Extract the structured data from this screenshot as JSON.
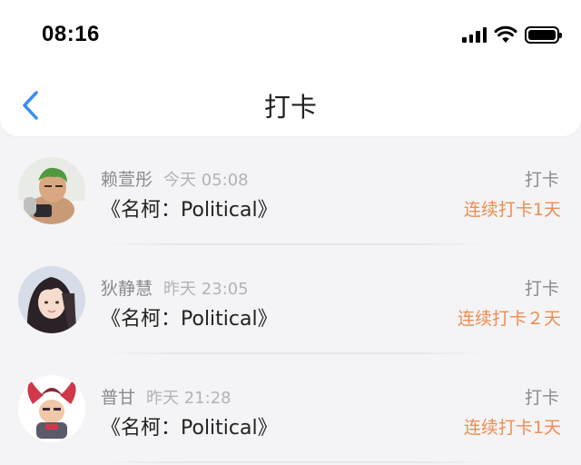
{
  "status_bar": {
    "time": "08:16"
  },
  "nav": {
    "title": "打卡"
  },
  "entries": [
    {
      "name": "赖萱彤",
      "time": "今天 05:08",
      "text": "《名柯：Political》",
      "label": "打卡",
      "streak": "连续打卡1天",
      "avatar_icon": "anime-avatar-icon"
    },
    {
      "name": "狄静慧",
      "time": "昨天 23:05",
      "text": "《名柯：Political》",
      "label": "打卡",
      "streak": "连续打卡２天",
      "avatar_icon": "girl-photo-avatar-icon"
    },
    {
      "name": "普甘",
      "time": "昨天 21:28",
      "text": "《名柯：Political》",
      "label": "打卡",
      "streak": "连续打卡1天",
      "avatar_icon": "cartoon-character-avatar-icon"
    }
  ],
  "colors": {
    "accent": "#3c8ef0",
    "streak": "#f08c4d",
    "background": "#f4f4f6"
  }
}
